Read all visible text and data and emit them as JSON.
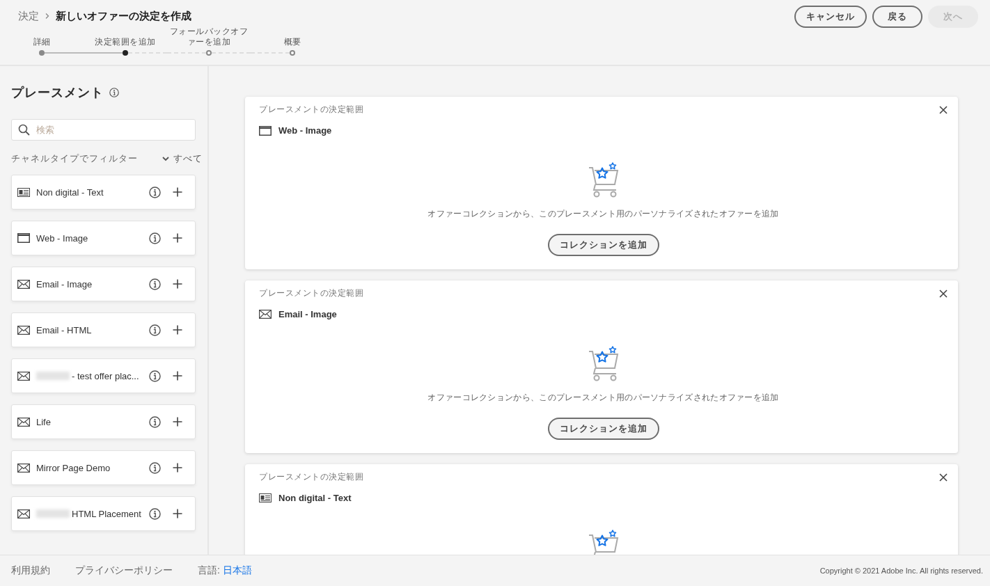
{
  "breadcrumb": {
    "parent": "決定",
    "current": "新しいオファーの決定を作成"
  },
  "steps": [
    {
      "label": "詳細",
      "done": true,
      "current": false
    },
    {
      "label": "決定範囲を追加",
      "done": false,
      "current": true
    },
    {
      "label": "フォールバックオファーを追加",
      "done": false,
      "current": false
    },
    {
      "label": "概要",
      "done": false,
      "current": false
    }
  ],
  "actions": [
    {
      "label": "キャンセル",
      "disabled": false
    },
    {
      "label": "戻る",
      "disabled": false
    },
    {
      "label": "次へ",
      "disabled": true
    }
  ],
  "sidebar": {
    "title": "プレースメント",
    "search": {
      "placeholder": "検索"
    },
    "filter": {
      "label": "チャネルタイプでフィルター",
      "value": "すべて"
    },
    "items": [
      {
        "kind": "text",
        "label": "Non digital - Text",
        "redacted": false
      },
      {
        "kind": "web",
        "label": "Web - Image",
        "redacted": false
      },
      {
        "kind": "email",
        "label": "Email - Image",
        "redacted": false
      },
      {
        "kind": "email",
        "label": "Email - HTML",
        "redacted": false
      },
      {
        "kind": "email",
        "label": "- test offer plac...",
        "redacted": true
      },
      {
        "kind": "email",
        "label": "Life",
        "redacted": false
      },
      {
        "kind": "email",
        "label": "Mirror Page Demo",
        "redacted": false
      },
      {
        "kind": "email",
        "label": "HTML Placement",
        "redacted": true
      }
    ]
  },
  "scopes": [
    {
      "caption": "プレースメントの決定範囲",
      "kind": "web",
      "placement": "Web - Image",
      "message": "オファーコレクションから、このプレースメント用のパーソナライズされたオファーを追加",
      "button": "コレクションを追加"
    },
    {
      "caption": "プレースメントの決定範囲",
      "kind": "email",
      "placement": "Email - Image",
      "message": "オファーコレクションから、このプレースメント用のパーソナライズされたオファーを追加",
      "button": "コレクションを追加"
    },
    {
      "caption": "プレースメントの決定範囲",
      "kind": "text",
      "placement": "Non digital - Text"
    }
  ],
  "footer": {
    "links": [
      "利用規約",
      "プライバシーポリシー"
    ],
    "language_label": "言語:",
    "language": "日本語",
    "copyright": "Copyright ©  2021 Adobe Inc.  All rights reserved."
  }
}
